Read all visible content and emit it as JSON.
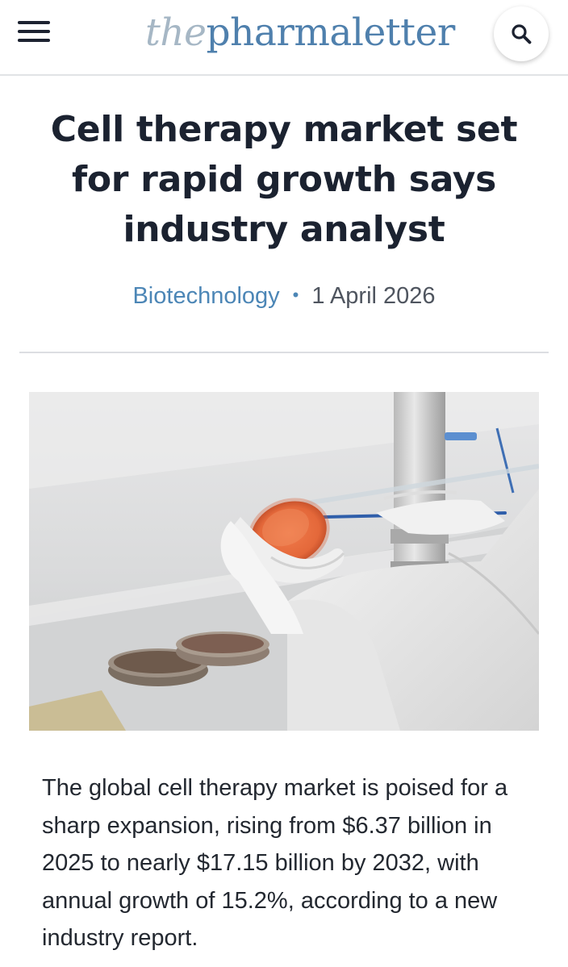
{
  "header": {
    "logo_prefix": "the",
    "logo_main": "pharmaletter",
    "menu_icon": "hamburger-menu-icon",
    "search_icon": "search-icon"
  },
  "article": {
    "title": "Cell therapy market set for rapid growth says industry analyst",
    "category": "Biotechnology",
    "separator": "•",
    "date": "1 April 2026",
    "image_alt": "Gloved hands holding a petri dish with orange culture medium in a laboratory",
    "lead": "The global cell therapy market is poised for a sharp expansion, rising from $6.37 billion in 2025 to nearly $17.15 billion by 2032, with annual growth of 15.2%, according to a new industry report."
  },
  "colors": {
    "brand_blue": "#4f80ad",
    "logo_light": "#a6b7c5",
    "category_link": "#4c86b6",
    "headline": "#1b2230"
  }
}
